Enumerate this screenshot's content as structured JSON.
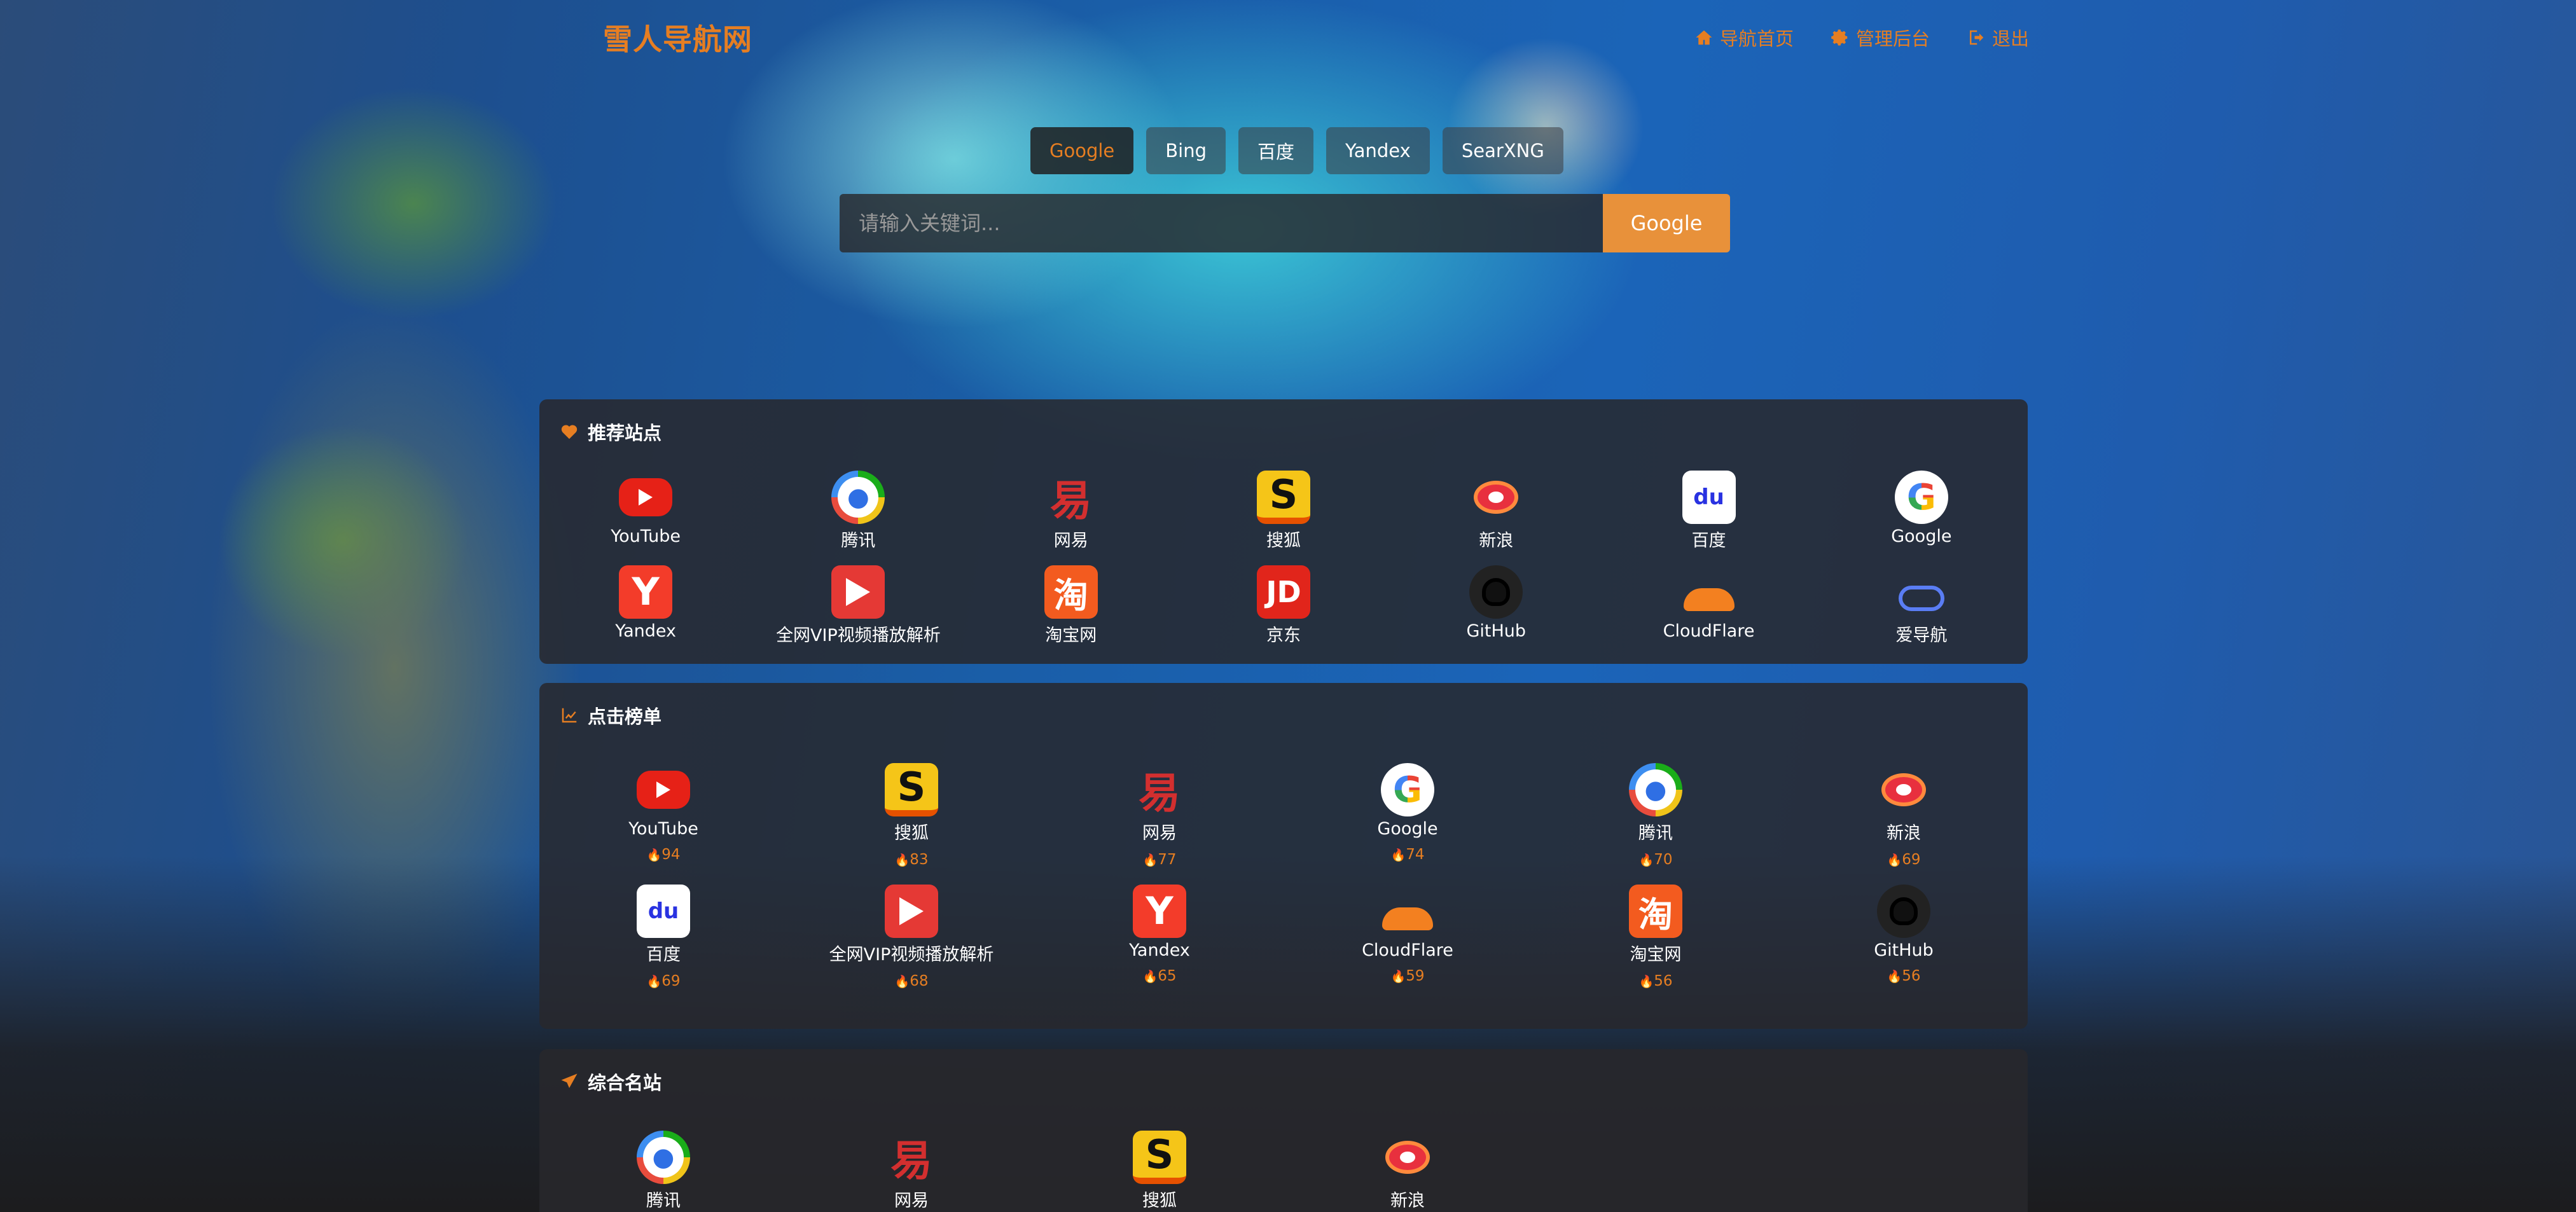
{
  "site": {
    "title": "雪人导航网"
  },
  "nav": [
    {
      "label": "导航首页",
      "icon": "home-icon"
    },
    {
      "label": "管理后台",
      "icon": "gear-icon"
    },
    {
      "label": "退出",
      "icon": "logout-icon"
    }
  ],
  "engines": [
    "Google",
    "Bing",
    "百度",
    "Yandex",
    "SearXNG"
  ],
  "active_engine": "Google",
  "search": {
    "placeholder": "请输入关键词...",
    "button_label": "Google"
  },
  "colors": {
    "accent": "#e67e22",
    "card_bg": "rgba(40,40,44,0.86)"
  },
  "sections": {
    "recommended": {
      "title": "推荐站点",
      "icon": "heart-icon",
      "items": [
        {
          "label": "YouTube",
          "icon": "youtube-icon"
        },
        {
          "label": "腾讯",
          "icon": "tencent-icon"
        },
        {
          "label": "网易",
          "icon": "netease-icon"
        },
        {
          "label": "搜狐",
          "icon": "sohu-icon"
        },
        {
          "label": "新浪",
          "icon": "sina-icon"
        },
        {
          "label": "百度",
          "icon": "baidu-icon"
        },
        {
          "label": "Google",
          "icon": "google-icon"
        },
        {
          "label": "Yandex",
          "icon": "yandex-icon"
        },
        {
          "label": "全网VIP视频播放解析",
          "icon": "vip-video-icon"
        },
        {
          "label": "淘宝网",
          "icon": "taobao-icon"
        },
        {
          "label": "京东",
          "icon": "jd-icon"
        },
        {
          "label": "GitHub",
          "icon": "github-icon"
        },
        {
          "label": "CloudFlare",
          "icon": "cloudflare-icon"
        },
        {
          "label": "爱导航",
          "icon": "aidaohang-icon"
        }
      ]
    },
    "ranking": {
      "title": "点击榜单",
      "icon": "chart-line-icon",
      "items": [
        {
          "label": "YouTube",
          "icon": "youtube-icon",
          "count": "94"
        },
        {
          "label": "搜狐",
          "icon": "sohu-icon",
          "count": "83"
        },
        {
          "label": "网易",
          "icon": "netease-icon",
          "count": "77"
        },
        {
          "label": "Google",
          "icon": "google-icon",
          "count": "74"
        },
        {
          "label": "腾讯",
          "icon": "tencent-icon",
          "count": "70"
        },
        {
          "label": "新浪",
          "icon": "sina-icon",
          "count": "69"
        },
        {
          "label": "百度",
          "icon": "baidu-icon",
          "count": "69"
        },
        {
          "label": "全网VIP视频播放解析",
          "icon": "vip-video-icon",
          "count": "68"
        },
        {
          "label": "Yandex",
          "icon": "yandex-icon",
          "count": "65"
        },
        {
          "label": "CloudFlare",
          "icon": "cloudflare-icon",
          "count": "59"
        },
        {
          "label": "淘宝网",
          "icon": "taobao-icon",
          "count": "56"
        },
        {
          "label": "GitHub",
          "icon": "github-icon",
          "count": "56"
        }
      ]
    },
    "portals": {
      "title": "综合名站",
      "icon": "paper-plane-icon",
      "items": [
        {
          "label": "腾讯",
          "icon": "tencent-icon"
        },
        {
          "label": "网易",
          "icon": "netease-icon"
        },
        {
          "label": "搜狐",
          "icon": "sohu-icon"
        },
        {
          "label": "新浪",
          "icon": "sina-icon"
        }
      ]
    }
  }
}
